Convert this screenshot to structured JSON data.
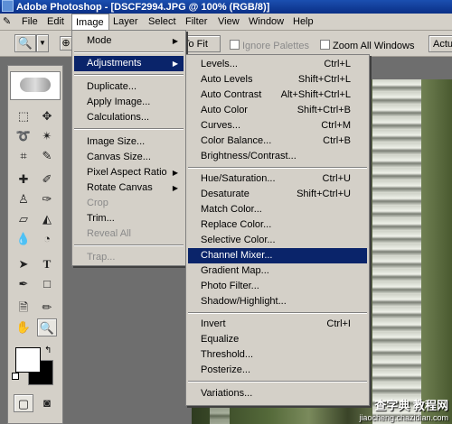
{
  "titlebar": {
    "title": "Adobe Photoshop - [DSCF2994.JPG @ 100% (RGB/8)]"
  },
  "menubar": {
    "items": [
      "File",
      "Edit",
      "Image",
      "Layer",
      "Select",
      "Filter",
      "View",
      "Window",
      "Help"
    ],
    "active": "Image"
  },
  "options_bar": {
    "to_fit": "To Fit",
    "ignore_palettes": "Ignore Palettes",
    "zoom_all_windows": "Zoom All Windows",
    "actual": "Actu"
  },
  "image_menu": {
    "items": [
      {
        "label": "Mode",
        "submenu": true
      },
      {
        "label": "Adjustments",
        "submenu": true,
        "highlighted": true
      },
      {
        "label": "Duplicate..."
      },
      {
        "label": "Apply Image..."
      },
      {
        "label": "Calculations..."
      },
      {
        "label": "Image Size..."
      },
      {
        "label": "Canvas Size..."
      },
      {
        "label": "Pixel Aspect Ratio",
        "submenu": true
      },
      {
        "label": "Rotate Canvas",
        "submenu": true
      },
      {
        "label": "Crop",
        "disabled": true
      },
      {
        "label": "Trim..."
      },
      {
        "label": "Reveal All",
        "disabled": true
      },
      {
        "label": "Trap...",
        "disabled": true
      }
    ]
  },
  "adjustments_menu": {
    "items": [
      {
        "label": "Levels...",
        "shortcut": "Ctrl+L"
      },
      {
        "label": "Auto Levels",
        "shortcut": "Shift+Ctrl+L"
      },
      {
        "label": "Auto Contrast",
        "shortcut": "Alt+Shift+Ctrl+L"
      },
      {
        "label": "Auto Color",
        "shortcut": "Shift+Ctrl+B"
      },
      {
        "label": "Curves...",
        "shortcut": "Ctrl+M"
      },
      {
        "label": "Color Balance...",
        "shortcut": "Ctrl+B"
      },
      {
        "label": "Brightness/Contrast...",
        "shortcut": ""
      },
      {
        "label": "Hue/Saturation...",
        "shortcut": "Ctrl+U"
      },
      {
        "label": "Desaturate",
        "shortcut": "Shift+Ctrl+U"
      },
      {
        "label": "Match Color...",
        "shortcut": ""
      },
      {
        "label": "Replace Color...",
        "shortcut": ""
      },
      {
        "label": "Selective Color...",
        "shortcut": ""
      },
      {
        "label": "Channel Mixer...",
        "shortcut": "",
        "highlighted": true
      },
      {
        "label": "Gradient Map...",
        "shortcut": ""
      },
      {
        "label": "Photo Filter...",
        "shortcut": ""
      },
      {
        "label": "Shadow/Highlight...",
        "shortcut": ""
      },
      {
        "label": "Invert",
        "shortcut": "Ctrl+I"
      },
      {
        "label": "Equalize",
        "shortcut": ""
      },
      {
        "label": "Threshold...",
        "shortcut": ""
      },
      {
        "label": "Posterize...",
        "shortcut": ""
      },
      {
        "label": "Variations...",
        "shortcut": ""
      }
    ]
  },
  "watermark": {
    "line1": "查字典 教程网",
    "line2": "jiaocheng.chazidian.com"
  },
  "colors": {
    "highlight": "#0a246a",
    "menu_bg": "#d4d0c8",
    "titlebar": "#0a2f86"
  }
}
